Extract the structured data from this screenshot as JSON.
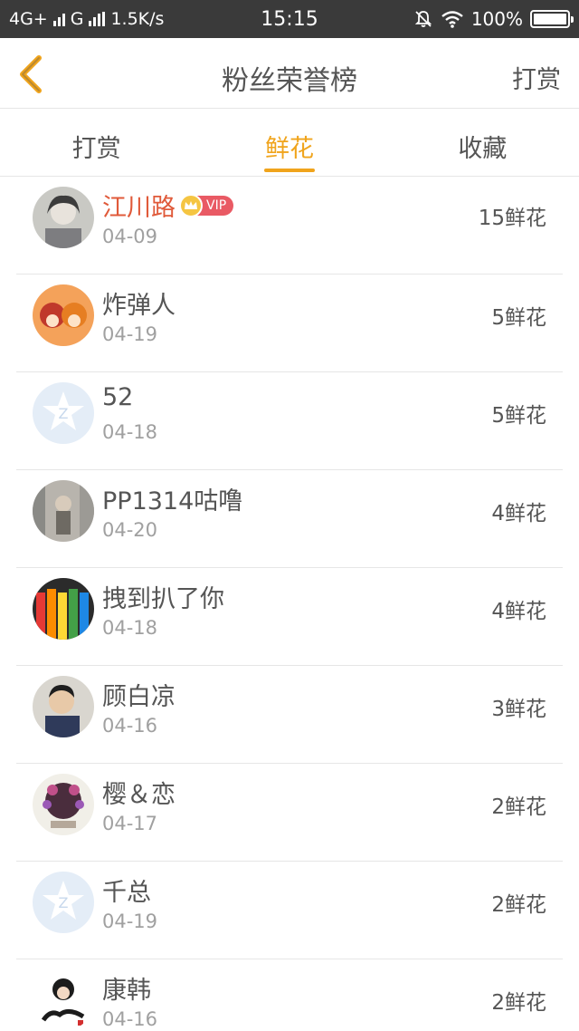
{
  "status_bar": {
    "network_left": "4G+",
    "network_right": "G",
    "speed": "1.5K/s",
    "time": "15:15",
    "battery": "100%"
  },
  "header": {
    "title": "粉丝荣誉榜",
    "right_action": "打赏"
  },
  "tabs": [
    {
      "label": "打赏",
      "active": false
    },
    {
      "label": "鲜花",
      "active": true
    },
    {
      "label": "收藏",
      "active": false
    }
  ],
  "colors": {
    "accent": "#f0a41c",
    "vip_name": "#e05a3a",
    "status_bar_bg": "#3a3a3a"
  },
  "fans": [
    {
      "name": "江川路",
      "date": "04-09",
      "amount": "15鲜花",
      "vip": true,
      "vip_label": "VIP",
      "avatar": "user-photo-avatar"
    },
    {
      "name": "炸弹人",
      "date": "04-19",
      "amount": "5鲜花",
      "vip": false,
      "avatar": "anime-girls-avatar"
    },
    {
      "name": "52",
      "date": "04-18",
      "amount": "5鲜花",
      "vip": false,
      "avatar": "default-qq-star-avatar"
    },
    {
      "name": "PP1314咕噜",
      "date": "04-20",
      "amount": "4鲜花",
      "vip": false,
      "avatar": "street-photo-avatar"
    },
    {
      "name": "拽到扒了你",
      "date": "04-18",
      "amount": "4鲜花",
      "vip": false,
      "avatar": "colored-pencils-avatar"
    },
    {
      "name": "顾白凉",
      "date": "04-16",
      "amount": "3鲜花",
      "vip": false,
      "avatar": "boy-photo-avatar"
    },
    {
      "name": "樱＆恋",
      "date": "04-17",
      "amount": "2鲜花",
      "vip": false,
      "avatar": "flower-wreath-avatar"
    },
    {
      "name": "千总",
      "date": "04-19",
      "amount": "2鲜花",
      "vip": false,
      "avatar": "default-qq-star-avatar"
    },
    {
      "name": "康韩",
      "date": "04-16",
      "amount": "2鲜花",
      "vip": false,
      "avatar": "cartoon-calligraphy-avatar"
    }
  ]
}
